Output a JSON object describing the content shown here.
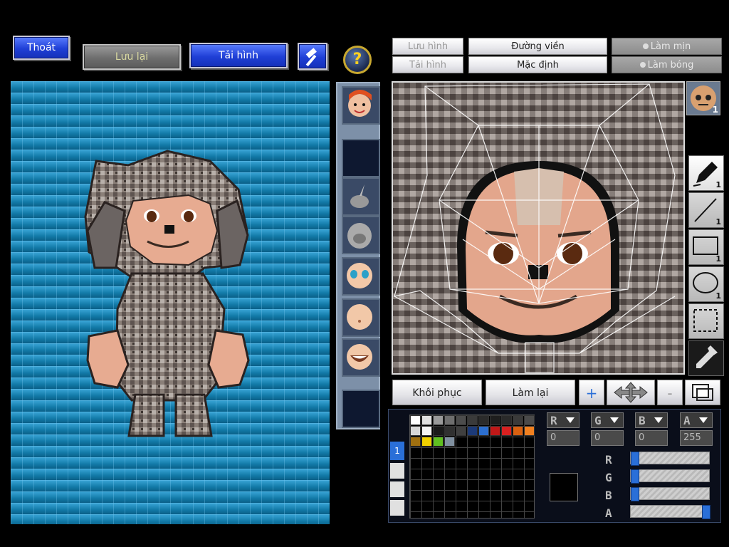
{
  "top_left": {
    "exit_label": "Thoát",
    "save_label": "Lưu lại",
    "load_label": "Tải hình",
    "help_label": "?"
  },
  "editor_top": {
    "save_image_label": "Lưu hình",
    "load_image_label": "Tải hình",
    "outline_label": "Đường viền",
    "default_label": "Mặc định",
    "smooth_label": "Làm mịn",
    "shade_label": "Làm bóng"
  },
  "editor_bottom": {
    "restore_label": "Khôi phục",
    "redo_label": "Làm lại",
    "zoom_in_symbol": "+",
    "zoom_out_symbol": "-"
  },
  "tools": [
    {
      "name": "pen",
      "count": "1"
    },
    {
      "name": "line",
      "count": "1"
    },
    {
      "name": "rectangle",
      "count": "1"
    },
    {
      "name": "ellipse",
      "count": "1"
    },
    {
      "name": "select",
      "count": ""
    },
    {
      "name": "eyedropper",
      "count": ""
    }
  ],
  "part_thumb_count": "1",
  "palette_tab": "1",
  "palette_colors": [
    "#ffffff",
    "#e0e0e0",
    "#9a9a9a",
    "#6e6e6e",
    "#4c4c4c",
    "#3a3a3a",
    "#2b2b2b",
    "#1e1e1e",
    "#2a2a2a",
    "#3a3a3a",
    "#4a4a4a",
    "#d8d8d8",
    "#f4f4f4",
    "#1a1a1a",
    "#303030",
    "#404040",
    "#1c3a78",
    "#2c6fd0",
    "#c01818",
    "#d82020",
    "#d86010",
    "#f08020",
    "#a07010",
    "#f0d000",
    "#60c020",
    "#8090a0"
  ],
  "color_channels": {
    "r": {
      "value": "0"
    },
    "g": {
      "value": "0"
    },
    "b": {
      "value": "0"
    },
    "a": {
      "value": "255"
    }
  },
  "sliders": {
    "r": 0,
    "g": 0,
    "b": 0,
    "a": 1
  },
  "colors": {
    "accent": "#1f3fd6",
    "canvas": "#1d7fb0"
  }
}
